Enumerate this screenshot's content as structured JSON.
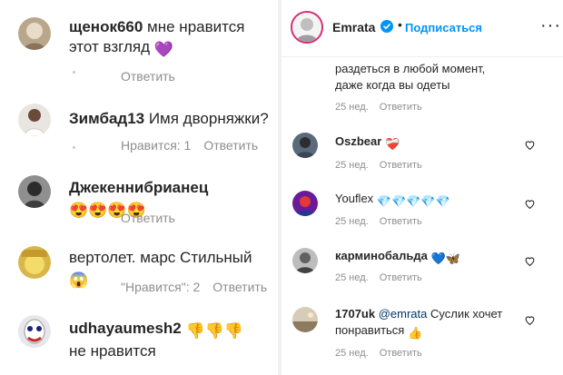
{
  "left": {
    "comments": [
      {
        "user": "щенок660",
        "text": " мне нравится этот взгляд",
        "emoji": "💜",
        "reply": "Ответить"
      },
      {
        "user": "Зимбад13",
        "text": " Имя дворняжки?",
        "likes": "Нравится: 1",
        "reply": "Ответить"
      },
      {
        "user": "Джекеннибрианец",
        "text": " ",
        "emoji": "😍😍😍😍",
        "reply": "Ответить"
      },
      {
        "user": "вертолет. марс",
        "text": " Стильный",
        "emoji": "😱",
        "likes": "\"Нравится\": 2",
        "reply": "Ответить"
      },
      {
        "user": "udhayaumesh2",
        "text": "не нравится",
        "emoji": "👎👎👎",
        "reply": ""
      }
    ]
  },
  "right": {
    "header": {
      "name": "Emrata",
      "dot": "•",
      "follow": "Подписаться",
      "more": "···"
    },
    "caption": {
      "text": "раздеться в любой момент, даже когда вы одеты",
      "time": "25 нед.",
      "reply": "Ответить"
    },
    "comments": [
      {
        "user": "Oszbear",
        "text": " ",
        "emoji": "❤️‍🩹",
        "time": "25 нед.",
        "reply": "Ответить"
      },
      {
        "user": "Youflex",
        "text": " ",
        "emoji": "💎💎💎💎💎",
        "time": "25 нед.",
        "reply": "Ответить"
      },
      {
        "user": "карминобальда",
        "text": " ",
        "emoji": "💙🦋",
        "time": "25 нед.",
        "reply": "Ответить"
      },
      {
        "user": "1707uk",
        "mention": "@emrata",
        "text": " Суслик хочет понравиться",
        "emoji": "👍",
        "time": "25 нед.",
        "reply": "Ответить"
      }
    ]
  },
  "colors": {
    "accent": "#0095f6",
    "muted": "#8e8e8e",
    "text": "#262626",
    "verified": "#0095f6"
  }
}
